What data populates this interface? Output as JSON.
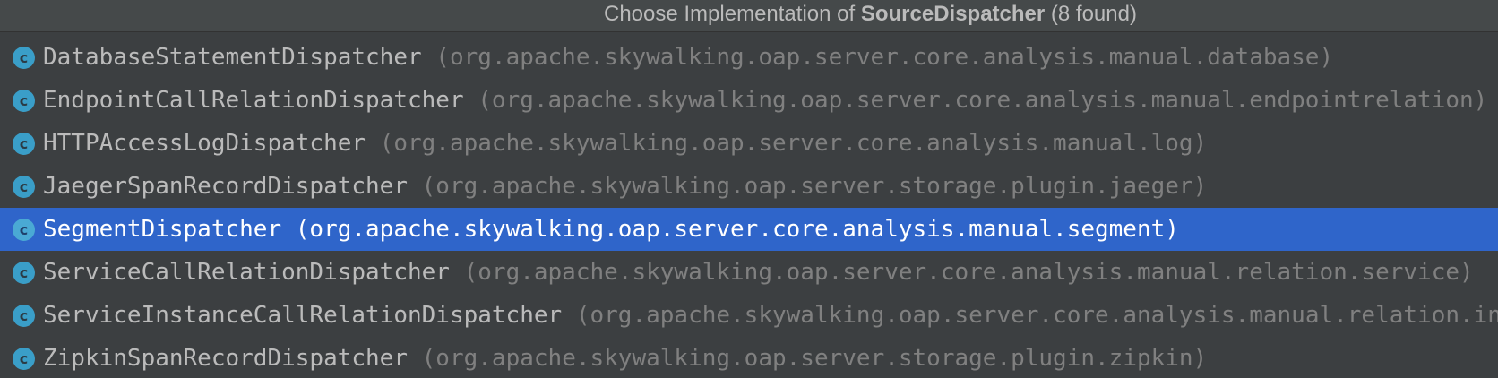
{
  "header": {
    "prefix": "Choose Implementation of ",
    "interface_name": "SourceDispatcher",
    "suffix": " (8 found)"
  },
  "colors": {
    "background": "#3c3f41",
    "selection": "#2f65ca",
    "class_name": "#bbbbbb",
    "package_name": "#808080",
    "class_icon": "#3a9ec8"
  },
  "items": [
    {
      "icon": "class-icon",
      "icon_glyph": "c",
      "name": "DatabaseStatementDispatcher",
      "package": "(org.apache.skywalking.oap.server.core.analysis.manual.database)",
      "selected": false
    },
    {
      "icon": "class-icon",
      "icon_glyph": "c",
      "name": "EndpointCallRelationDispatcher",
      "package": "(org.apache.skywalking.oap.server.core.analysis.manual.endpointrelation)",
      "selected": false
    },
    {
      "icon": "class-icon",
      "icon_glyph": "c",
      "name": "HTTPAccessLogDispatcher",
      "package": "(org.apache.skywalking.oap.server.core.analysis.manual.log)",
      "selected": false
    },
    {
      "icon": "class-icon",
      "icon_glyph": "c",
      "name": "JaegerSpanRecordDispatcher",
      "package": "(org.apache.skywalking.oap.server.storage.plugin.jaeger)",
      "selected": false
    },
    {
      "icon": "class-icon",
      "icon_glyph": "c",
      "name": "SegmentDispatcher",
      "package": "(org.apache.skywalking.oap.server.core.analysis.manual.segment)",
      "selected": true
    },
    {
      "icon": "class-icon",
      "icon_glyph": "c",
      "name": "ServiceCallRelationDispatcher",
      "package": "(org.apache.skywalking.oap.server.core.analysis.manual.relation.service)",
      "selected": false
    },
    {
      "icon": "class-icon",
      "icon_glyph": "c",
      "name": "ServiceInstanceCallRelationDispatcher",
      "package": "(org.apache.skywalking.oap.server.core.analysis.manual.relation.instance)",
      "selected": false
    },
    {
      "icon": "class-icon",
      "icon_glyph": "c",
      "name": "ZipkinSpanRecordDispatcher",
      "package": "(org.apache.skywalking.oap.server.storage.plugin.zipkin)",
      "selected": false
    }
  ]
}
